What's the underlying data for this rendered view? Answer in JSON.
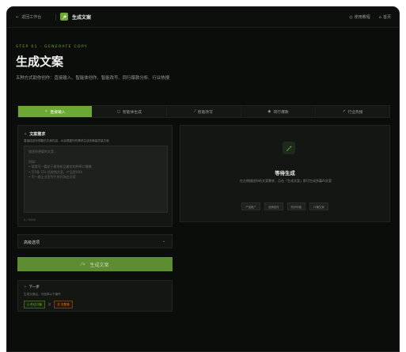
{
  "topbar": {
    "back_label": "返回工作台",
    "brand_title": "生成文案",
    "right_items": [
      {
        "label": "使用教程",
        "icon": "help-icon"
      },
      {
        "label": "首页",
        "icon": "home-icon"
      }
    ]
  },
  "hero": {
    "step_label": "STEP 01 · GENERATE COPY",
    "title": "生成文案",
    "subtitle": "五种方式助你创作：直接输入、智能体创作、智能改写、同行爆款分析、行业热搜"
  },
  "tabs": [
    {
      "label": "直接输入",
      "icon": "sparkle-icon",
      "active": true
    },
    {
      "label": "智能体生成",
      "icon": "robot-icon",
      "active": false
    },
    {
      "label": "智能改写",
      "icon": "magic-wand-icon",
      "active": false
    },
    {
      "label": "同行爆款",
      "icon": "eye-icon",
      "active": false
    },
    {
      "label": "行业热搜",
      "icon": "trend-icon",
      "active": false
    }
  ],
  "requirement": {
    "title": "文案需求",
    "description": "直接描述你想要的文案内容，AI会根据你的需求生成多篇高质量文案",
    "placeholder_lines": [
      "描述你想要的文案...",
      "",
      "例如：",
      "• 帮我写一篇关于夏季新品美妆的种草口播稿",
      "• 写5条 15s 短视频文案，产品是XXX",
      "• 写一段企业宣传片的开场白文案"
    ],
    "counter": "0 / 5000"
  },
  "waiting": {
    "title": "等待生成",
    "description": "在左侧描述你的文案需求，点击「生成文案」即可生成多篇AI文案",
    "chips": [
      "产品推广",
      "品牌宣传",
      "知识科普",
      "口播文案"
    ]
  },
  "advanced": {
    "label": "高级选项"
  },
  "generate_button": {
    "label": "生成文案"
  },
  "next_step": {
    "title": "下一步",
    "description": "生成文案后，可选择以下操作",
    "actions": [
      "前往口播",
      "或",
      "去 去配音"
    ]
  },
  "colors": {
    "accent_green": "#6ea834",
    "background": "#0b0d0b",
    "accent_orange": "#e08a2c"
  }
}
